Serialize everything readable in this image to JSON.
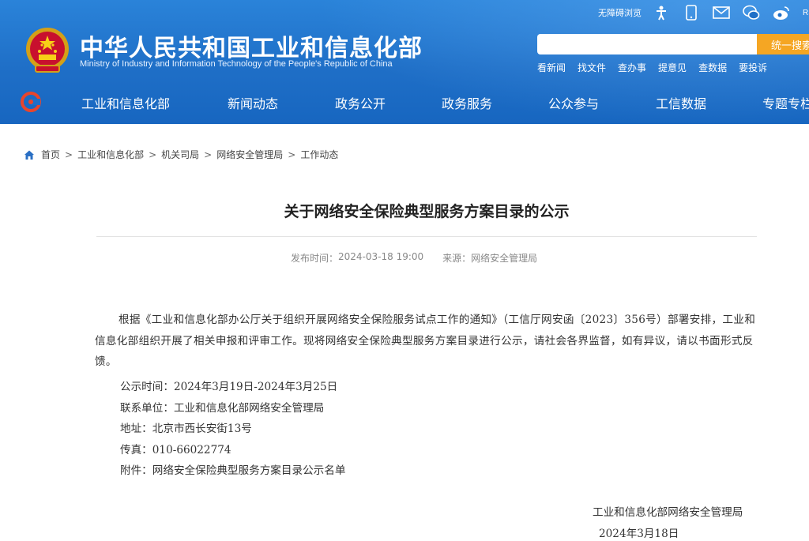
{
  "header": {
    "site_title": "中华人民共和国工业和信息化部",
    "site_subtitle": "Ministry of Industry and Information Technology of the People's Republic of China",
    "brand_color": "#1f6fc7",
    "accent_color": "#f5a623",
    "utility": {
      "accessible_label": "无障碍浏览",
      "rss_label": "RSS",
      "icons": [
        "accessibility-icon",
        "mobile-icon",
        "mail-icon",
        "wechat-icon",
        "weibo-icon"
      ]
    },
    "search": {
      "value": "",
      "placeholder": "",
      "button_label": "统一搜索"
    },
    "quick_links": [
      "看新闻",
      "找文件",
      "查办事",
      "提意见",
      "查数据",
      "要投诉"
    ]
  },
  "nav": {
    "items": [
      "工业和信息化部",
      "新闻动态",
      "政务公开",
      "政务服务",
      "公众参与",
      "工信数据",
      "专题专栏"
    ]
  },
  "breadcrumb": [
    "首页",
    "工业和信息化部",
    "机关司局",
    "网络安全管理局",
    "工作动态"
  ],
  "article": {
    "title": "关于网络安全保险典型服务方案目录的公示",
    "publish_label": "发布时间：",
    "publish_time": "2024-03-18 19:00",
    "source_label": "来源：",
    "source": "网络安全管理局",
    "body": "根据《工业和信息化部办公厅关于组织开展网络安全保险服务试点工作的通知》（工信厅网安函〔2023〕356号）部署安排，工业和信息化部组织开展了相关申报和评审工作。现将网络安全保险典型服务方案目录进行公示，请社会各界监督，如有异议，请以书面形式反馈。",
    "info": [
      "公示时间：2024年3月19日-2024年3月25日",
      "联系单位：工业和信息化部网络安全管理局",
      "地址：北京市西长安街13号",
      "传真：010-66022774",
      "附件：网络安全保险典型服务方案目录公示名单"
    ],
    "signature_org": "工业和信息化部网络安全管理局",
    "signature_date": "2024年3月18日"
  }
}
